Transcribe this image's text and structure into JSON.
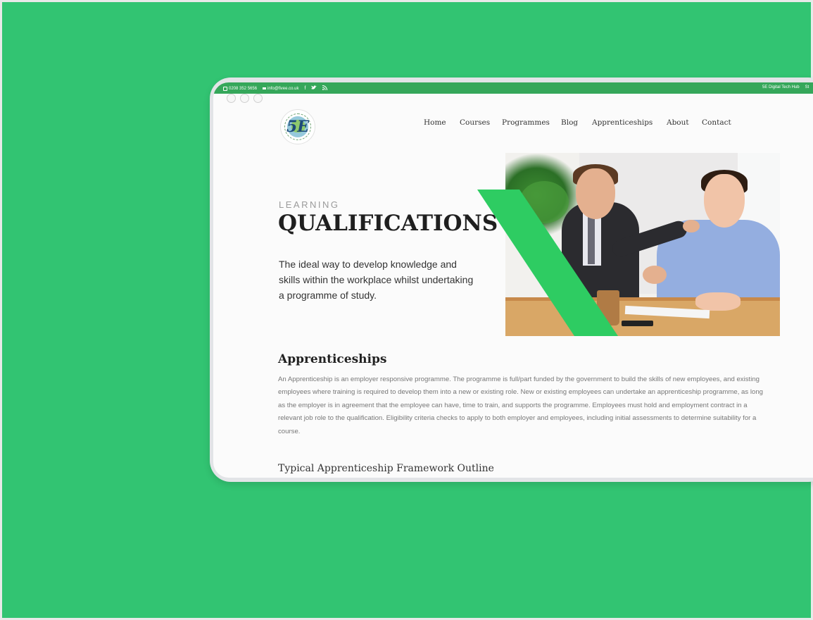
{
  "topbar": {
    "phone": "0208 352 5656",
    "email": "info@fivee.co.uk",
    "social": [
      "f",
      "t",
      "rss"
    ],
    "right_links": [
      "5E Digital Tech Hub",
      "St"
    ]
  },
  "logo": {
    "mark": "5E"
  },
  "nav": {
    "items": [
      "Home",
      "Courses",
      "Programmes",
      "Blog",
      "Apprenticeships",
      "About",
      "Contact"
    ]
  },
  "hero": {
    "eyebrow": "LEARNING",
    "title": "QUALIFICATIONS",
    "lead": "The ideal way to develop knowledge and skills within the workplace whilst undertaking a programme of study."
  },
  "section": {
    "heading": "Apprenticeships",
    "body": "An Apprenticeship is an employer responsive programme. The programme is full/part funded by the government to build the skills of new employees, and existing employees where training is required to develop them into a new or existing role. New or existing employees can undertake an apprenticeship programme, as long as the employer is in agreement that the employee can have, time to train, and supports the programme. Employees must hold and employment contract in a relevant job role to the qualification. Eligibility criteria checks to apply to both employer and employees, including initial assessments to determine suitability for a course.",
    "subheading": "Typical Apprenticeship Framework Outline"
  },
  "colors": {
    "background": "#32c472",
    "topbar": "#35a75a",
    "accent": "#2ecc62"
  }
}
